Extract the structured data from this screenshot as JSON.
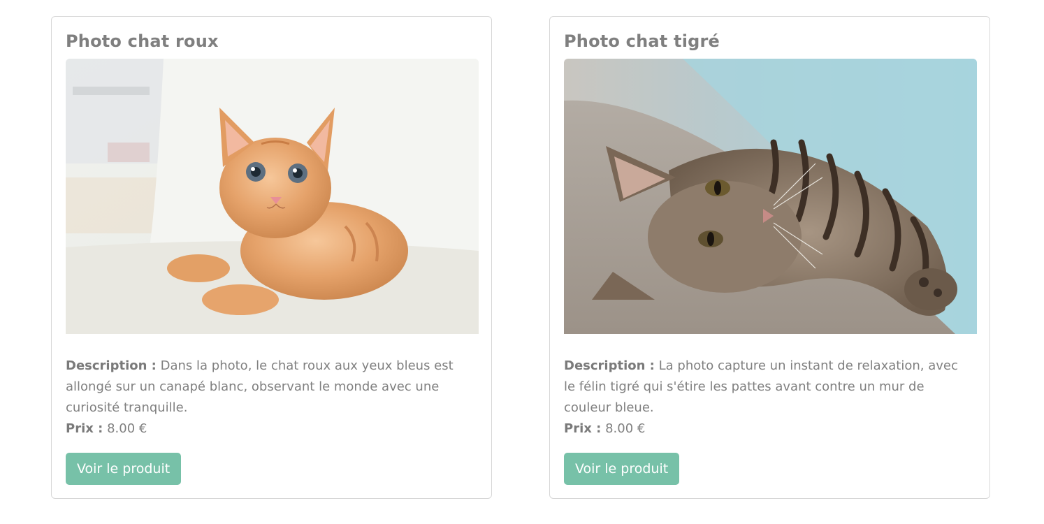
{
  "products": [
    {
      "title": "Photo chat roux",
      "image_subject": "orange kitten on white sofa",
      "description_label": "Description :",
      "description": "Dans la photo, le chat roux aux yeux bleus est allongé sur un canapé blanc, observant le monde avec une curiosité tranquille.",
      "price_label": "Prix :",
      "price": "8.00 €",
      "button_label": "Voir le produit"
    },
    {
      "title": "Photo chat tigré",
      "image_subject": "tabby cat stretching against blue wall",
      "description_label": "Description :",
      "description": "La photo capture un instant de relaxation, avec le félin tigré qui s'étire les pattes avant contre un mur de couleur bleue.",
      "price_label": "Prix :",
      "price": "8.00 €",
      "button_label": "Voir le produit"
    }
  ],
  "colors": {
    "accent_button": "#77c1a8",
    "text": "#808080",
    "card_border": "#d7d7d7"
  }
}
